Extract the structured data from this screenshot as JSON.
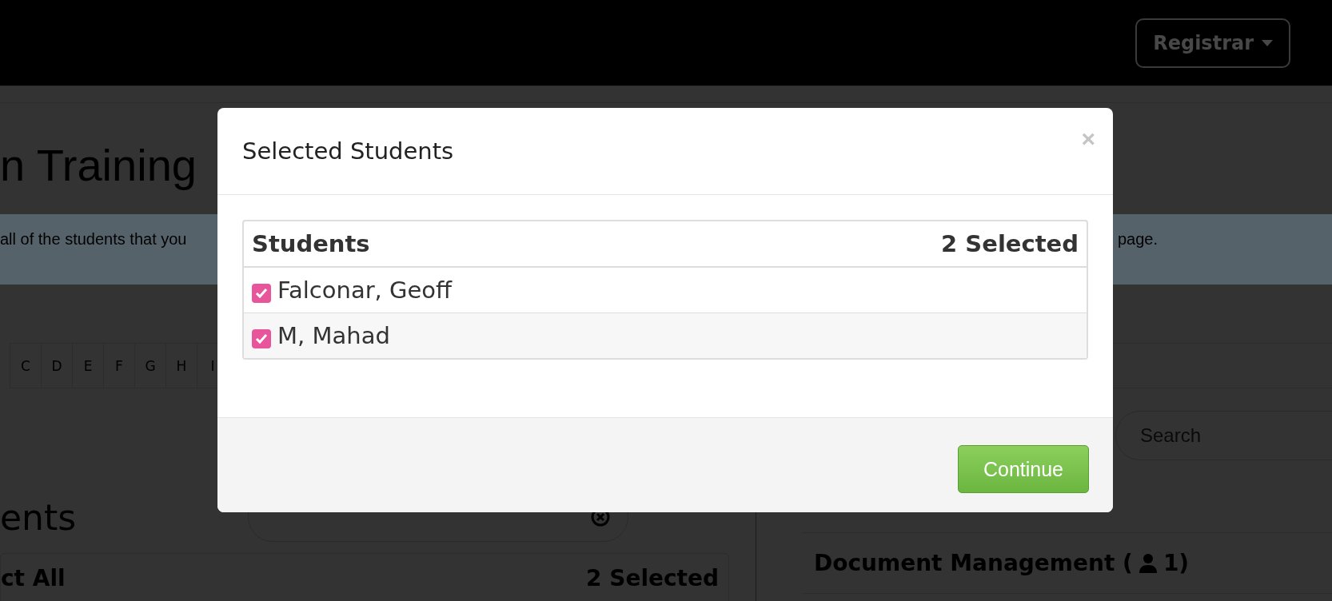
{
  "navbar": {
    "menu_button": "Registrar"
  },
  "page": {
    "heading": "n Training",
    "notice": [
      "all of the students that you",
      "page."
    ],
    "letters": [
      "C",
      "D",
      "E",
      "F",
      "G",
      "H",
      "I"
    ],
    "section_heading": "ents",
    "select_all": {
      "label": "ct All",
      "count": "2 Selected"
    },
    "right_search": {
      "placeholder": "Search"
    },
    "courses": [
      {
        "name": "Document Management (",
        "count": "1)"
      }
    ]
  },
  "modal": {
    "title": "Selected Students",
    "close": "×",
    "table": {
      "heading": "Students",
      "count": "2 Selected",
      "rows": [
        {
          "name": "Falconar, Geoff",
          "checked": true
        },
        {
          "name": "M, Mahad",
          "checked": true
        }
      ]
    },
    "button": "Continue"
  }
}
